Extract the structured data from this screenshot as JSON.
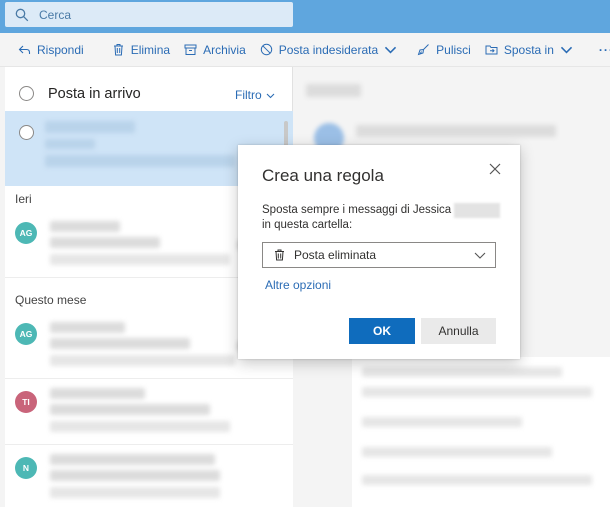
{
  "search": {
    "placeholder": "Cerca"
  },
  "toolbar": {
    "reply": "Rispondi",
    "delete": "Elimina",
    "archive": "Archivia",
    "junk": "Posta indesiderata",
    "sweep": "Pulisci",
    "move": "Sposta in",
    "more": "···"
  },
  "inbox": {
    "title": "Posta in arrivo",
    "filter": "Filtro",
    "sections": {
      "yesterday": "Ieri",
      "this_month": "Questo mese"
    },
    "avatars": [
      {
        "initials": "AG",
        "color": "#4db8b5"
      },
      {
        "initials": "AG",
        "color": "#4db8b5"
      },
      {
        "initials": "TI",
        "color": "#c9647a"
      },
      {
        "initials": "N",
        "color": "#4db8b5"
      }
    ]
  },
  "dialog": {
    "title": "Crea una regola",
    "message_line1": "Sposta sempre i messaggi di Jessica",
    "message_line2": "in questa cartella:",
    "folder_value": "Posta eliminata",
    "more_options": "Altre opzioni",
    "ok_label": "OK",
    "cancel_label": "Annulla"
  },
  "colors": {
    "accent": "#0f6cbd",
    "topbar": "#5fa6de",
    "link": "#2b6cb5"
  }
}
